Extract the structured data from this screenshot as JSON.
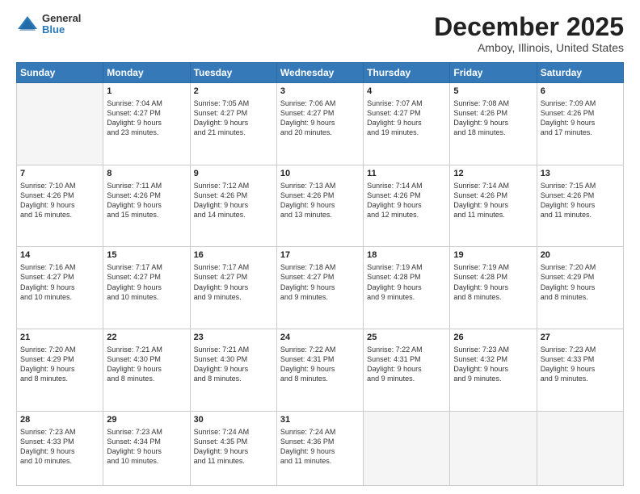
{
  "header": {
    "logo_general": "General",
    "logo_blue": "Blue",
    "title": "December 2025",
    "location": "Amboy, Illinois, United States"
  },
  "weekdays": [
    "Sunday",
    "Monday",
    "Tuesday",
    "Wednesday",
    "Thursday",
    "Friday",
    "Saturday"
  ],
  "weeks": [
    [
      {
        "day": "",
        "info": ""
      },
      {
        "day": "1",
        "info": "Sunrise: 7:04 AM\nSunset: 4:27 PM\nDaylight: 9 hours\nand 23 minutes."
      },
      {
        "day": "2",
        "info": "Sunrise: 7:05 AM\nSunset: 4:27 PM\nDaylight: 9 hours\nand 21 minutes."
      },
      {
        "day": "3",
        "info": "Sunrise: 7:06 AM\nSunset: 4:27 PM\nDaylight: 9 hours\nand 20 minutes."
      },
      {
        "day": "4",
        "info": "Sunrise: 7:07 AM\nSunset: 4:27 PM\nDaylight: 9 hours\nand 19 minutes."
      },
      {
        "day": "5",
        "info": "Sunrise: 7:08 AM\nSunset: 4:26 PM\nDaylight: 9 hours\nand 18 minutes."
      },
      {
        "day": "6",
        "info": "Sunrise: 7:09 AM\nSunset: 4:26 PM\nDaylight: 9 hours\nand 17 minutes."
      }
    ],
    [
      {
        "day": "7",
        "info": "Sunrise: 7:10 AM\nSunset: 4:26 PM\nDaylight: 9 hours\nand 16 minutes."
      },
      {
        "day": "8",
        "info": "Sunrise: 7:11 AM\nSunset: 4:26 PM\nDaylight: 9 hours\nand 15 minutes."
      },
      {
        "day": "9",
        "info": "Sunrise: 7:12 AM\nSunset: 4:26 PM\nDaylight: 9 hours\nand 14 minutes."
      },
      {
        "day": "10",
        "info": "Sunrise: 7:13 AM\nSunset: 4:26 PM\nDaylight: 9 hours\nand 13 minutes."
      },
      {
        "day": "11",
        "info": "Sunrise: 7:14 AM\nSunset: 4:26 PM\nDaylight: 9 hours\nand 12 minutes."
      },
      {
        "day": "12",
        "info": "Sunrise: 7:14 AM\nSunset: 4:26 PM\nDaylight: 9 hours\nand 11 minutes."
      },
      {
        "day": "13",
        "info": "Sunrise: 7:15 AM\nSunset: 4:26 PM\nDaylight: 9 hours\nand 11 minutes."
      }
    ],
    [
      {
        "day": "14",
        "info": "Sunrise: 7:16 AM\nSunset: 4:27 PM\nDaylight: 9 hours\nand 10 minutes."
      },
      {
        "day": "15",
        "info": "Sunrise: 7:17 AM\nSunset: 4:27 PM\nDaylight: 9 hours\nand 10 minutes."
      },
      {
        "day": "16",
        "info": "Sunrise: 7:17 AM\nSunset: 4:27 PM\nDaylight: 9 hours\nand 9 minutes."
      },
      {
        "day": "17",
        "info": "Sunrise: 7:18 AM\nSunset: 4:27 PM\nDaylight: 9 hours\nand 9 minutes."
      },
      {
        "day": "18",
        "info": "Sunrise: 7:19 AM\nSunset: 4:28 PM\nDaylight: 9 hours\nand 9 minutes."
      },
      {
        "day": "19",
        "info": "Sunrise: 7:19 AM\nSunset: 4:28 PM\nDaylight: 9 hours\nand 8 minutes."
      },
      {
        "day": "20",
        "info": "Sunrise: 7:20 AM\nSunset: 4:29 PM\nDaylight: 9 hours\nand 8 minutes."
      }
    ],
    [
      {
        "day": "21",
        "info": "Sunrise: 7:20 AM\nSunset: 4:29 PM\nDaylight: 9 hours\nand 8 minutes."
      },
      {
        "day": "22",
        "info": "Sunrise: 7:21 AM\nSunset: 4:30 PM\nDaylight: 9 hours\nand 8 minutes."
      },
      {
        "day": "23",
        "info": "Sunrise: 7:21 AM\nSunset: 4:30 PM\nDaylight: 9 hours\nand 8 minutes."
      },
      {
        "day": "24",
        "info": "Sunrise: 7:22 AM\nSunset: 4:31 PM\nDaylight: 9 hours\nand 8 minutes."
      },
      {
        "day": "25",
        "info": "Sunrise: 7:22 AM\nSunset: 4:31 PM\nDaylight: 9 hours\nand 9 minutes."
      },
      {
        "day": "26",
        "info": "Sunrise: 7:23 AM\nSunset: 4:32 PM\nDaylight: 9 hours\nand 9 minutes."
      },
      {
        "day": "27",
        "info": "Sunrise: 7:23 AM\nSunset: 4:33 PM\nDaylight: 9 hours\nand 9 minutes."
      }
    ],
    [
      {
        "day": "28",
        "info": "Sunrise: 7:23 AM\nSunset: 4:33 PM\nDaylight: 9 hours\nand 10 minutes."
      },
      {
        "day": "29",
        "info": "Sunrise: 7:23 AM\nSunset: 4:34 PM\nDaylight: 9 hours\nand 10 minutes."
      },
      {
        "day": "30",
        "info": "Sunrise: 7:24 AM\nSunset: 4:35 PM\nDaylight: 9 hours\nand 11 minutes."
      },
      {
        "day": "31",
        "info": "Sunrise: 7:24 AM\nSunset: 4:36 PM\nDaylight: 9 hours\nand 11 minutes."
      },
      {
        "day": "",
        "info": ""
      },
      {
        "day": "",
        "info": ""
      },
      {
        "day": "",
        "info": ""
      }
    ]
  ]
}
